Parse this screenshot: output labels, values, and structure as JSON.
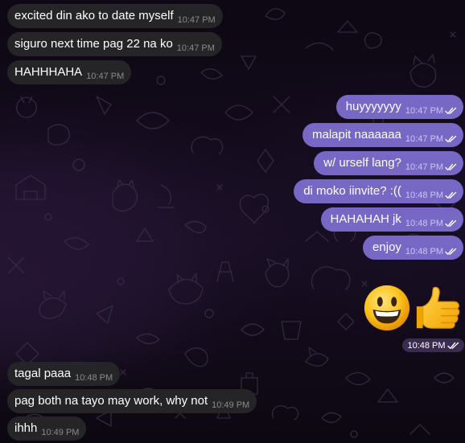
{
  "chat": {
    "messages": [
      {
        "text": "excited din ako to date myself",
        "time": "10:47 PM",
        "direction": "incoming"
      },
      {
        "text": "siguro next time pag 22 na ko",
        "time": "10:47 PM",
        "direction": "incoming"
      },
      {
        "text": "HAHHHAHA",
        "time": "10:47 PM",
        "direction": "incoming"
      },
      {
        "text": "huyyyyyyy",
        "time": "10:47 PM",
        "direction": "outgoing",
        "status": "read"
      },
      {
        "text": "malapit naaaaaa",
        "time": "10:47 PM",
        "direction": "outgoing",
        "status": "read"
      },
      {
        "text": "w/ urself lang?",
        "time": "10:47 PM",
        "direction": "outgoing",
        "status": "read"
      },
      {
        "text": "di moko iinvite? :((",
        "time": "10:48 PM",
        "direction": "outgoing",
        "status": "read"
      },
      {
        "text": "HAHAHAH jk",
        "time": "10:48 PM",
        "direction": "outgoing",
        "status": "read"
      },
      {
        "text": "enjoy",
        "time": "10:48 PM",
        "direction": "outgoing",
        "status": "read"
      },
      {
        "text": "tagal paaa",
        "time": "10:48 PM",
        "direction": "incoming"
      },
      {
        "text": "pag both na tayo may work, why not",
        "time": "10:49 PM",
        "direction": "incoming"
      },
      {
        "text": "ihhh",
        "time": "10:49 PM",
        "direction": "incoming"
      }
    ],
    "sticker_message": {
      "icons": [
        "smiling-face-emoji-icon",
        "thumbs-up-emoji-icon"
      ],
      "time": "10:48 PM",
      "direction": "outgoing",
      "status": "read"
    }
  },
  "colors": {
    "incoming_bubble": "#252527",
    "outgoing_bubble": "#7868c6",
    "incoming_time": "#8b8b8e",
    "outgoing_time": "#cdc5f1",
    "read_ticks": "#ffffff",
    "background": "#120a1a"
  }
}
